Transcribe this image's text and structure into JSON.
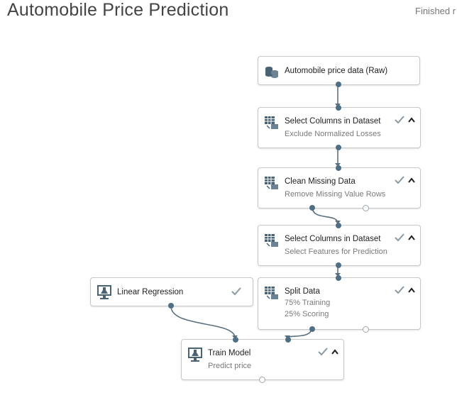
{
  "header": {
    "title": "Automobile Price Prediction",
    "status": "Finished r"
  },
  "nodes": [
    {
      "id": "automobile-price-data",
      "icon": "dataset-icon",
      "title": "Automobile price data (Raw)",
      "subtitle": [],
      "status": "none"
    },
    {
      "id": "select-columns-1",
      "icon": "select-columns-icon",
      "title": "Select Columns in Dataset",
      "subtitle": [
        "Exclude Normalized Losses"
      ],
      "status": "finished"
    },
    {
      "id": "clean-missing-data",
      "icon": "clean-data-icon",
      "title": "Clean Missing Data",
      "subtitle": [
        "Remove Missing Value Rows"
      ],
      "status": "finished"
    },
    {
      "id": "select-columns-2",
      "icon": "select-columns-icon",
      "title": "Select Columns in Dataset",
      "subtitle": [
        "Select Features for Prediction"
      ],
      "status": "finished"
    },
    {
      "id": "split-data",
      "icon": "split-data-icon",
      "title": "Split Data",
      "subtitle": [
        "75% Training",
        "25% Scoring"
      ],
      "status": "finished"
    },
    {
      "id": "linear-regression",
      "icon": "model-icon",
      "title": "Linear Regression",
      "subtitle": [],
      "status": "finished"
    },
    {
      "id": "train-model",
      "icon": "model-icon",
      "title": "Train Model",
      "subtitle": [
        "Predict price"
      ],
      "status": "finished"
    }
  ],
  "colors": {
    "wire": "#5a7182",
    "port": "#4f6f86",
    "check": "#8a9aa5",
    "icon": "#4a6374"
  }
}
